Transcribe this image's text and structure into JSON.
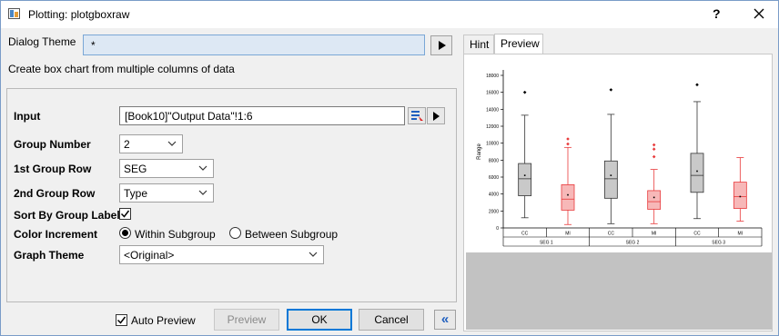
{
  "window": {
    "title": "Plotting: plotgboxraw",
    "help": "?",
    "close_icon": "close-icon"
  },
  "dialog": {
    "theme_label": "Dialog Theme",
    "theme_value": "*",
    "description": "Create box chart from multiple columns of data"
  },
  "form": {
    "input_label": "Input",
    "input_value": "[Book10]\"Output Data\"!1:6",
    "group_number_label": "Group Number",
    "group_number_value": "2",
    "first_group_row_label": "1st Group Row",
    "first_group_row_value": "SEG",
    "second_group_row_label": "2nd Group Row",
    "second_group_row_value": "Type",
    "sort_label": "Sort By Group Labels",
    "sort_checked": true,
    "color_increment_label": "Color Increment",
    "color_option_1": "Within Subgroup",
    "color_option_2": "Between Subgroup",
    "color_selected": "Within Subgroup",
    "graph_theme_label": "Graph Theme",
    "graph_theme_value": "<Original>"
  },
  "footer": {
    "auto_preview_label": "Auto Preview",
    "auto_preview_checked": true,
    "preview_btn": "Preview",
    "ok_btn": "OK",
    "cancel_btn": "Cancel",
    "collapse_glyph": "«"
  },
  "tabs": [
    "Hint",
    "Preview"
  ],
  "active_tab": "Preview",
  "colors": {
    "gray_box": "#c9c9c9",
    "red_box": "#f7b8b8",
    "red_line": "#e8393a",
    "accent": "#0078d7"
  },
  "chart_data": {
    "type": "box",
    "ylabel": "Range",
    "ylim": [
      0,
      18000
    ],
    "yticks": [
      0,
      2000,
      4000,
      6000,
      8000,
      10000,
      12000,
      14000,
      16000,
      18000
    ],
    "groups": [
      "SEG 1",
      "SEG 2",
      "SEG 3"
    ],
    "subgroups": [
      "CC",
      "MI"
    ],
    "boxes": [
      {
        "group": "SEG 1",
        "sub": "CC",
        "min": 1200,
        "q1": 3800,
        "median": 5800,
        "q3": 7600,
        "max": 13300,
        "mean": 6200,
        "outliers": [
          16000
        ]
      },
      {
        "group": "SEG 1",
        "sub": "MI",
        "min": 400,
        "q1": 2100,
        "median": 3400,
        "q3": 5100,
        "max": 9500,
        "mean": 3900,
        "outliers": [
          9900,
          10500
        ]
      },
      {
        "group": "SEG 2",
        "sub": "CC",
        "min": 500,
        "q1": 3500,
        "median": 5800,
        "q3": 7900,
        "max": 13400,
        "mean": 6200,
        "outliers": [
          16300
        ]
      },
      {
        "group": "SEG 2",
        "sub": "MI",
        "min": 500,
        "q1": 2200,
        "median": 3100,
        "q3": 4400,
        "max": 6900,
        "mean": 3600,
        "outliers": [
          8400,
          9300,
          9800
        ]
      },
      {
        "group": "SEG 3",
        "sub": "CC",
        "min": 1100,
        "q1": 4200,
        "median": 6200,
        "q3": 8800,
        "max": 14900,
        "mean": 6700,
        "outliers": [
          16900
        ]
      },
      {
        "group": "SEG 3",
        "sub": "MI",
        "min": 800,
        "q1": 2300,
        "median": 3700,
        "q3": 5400,
        "max": 8300,
        "mean": 3700,
        "outliers": []
      }
    ]
  }
}
